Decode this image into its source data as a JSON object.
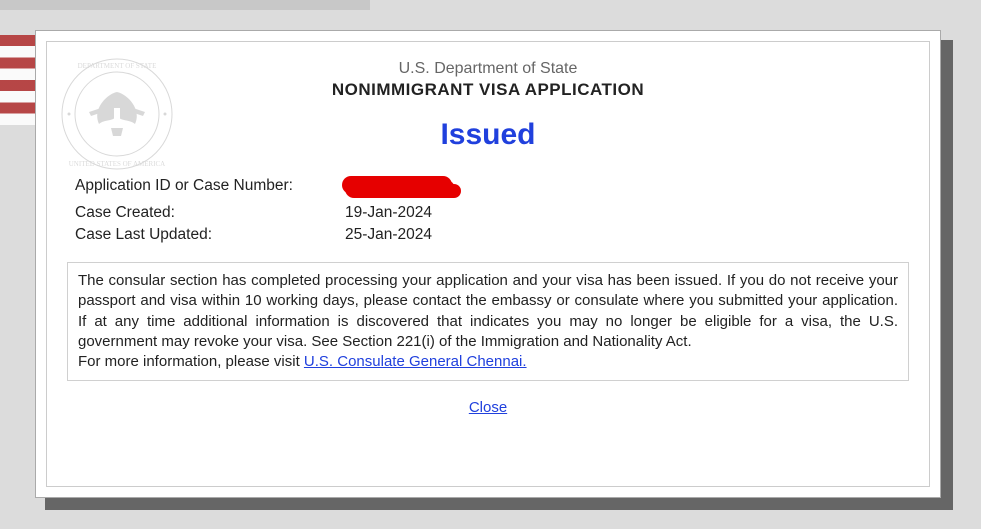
{
  "header": {
    "department": "U.S. Department of State",
    "title": "NONIMMIGRANT VISA APPLICATION"
  },
  "status": "Issued",
  "details": {
    "app_id_label": "Application ID or Case Number:",
    "app_id_value": "",
    "created_label": "Case Created:",
    "created_value": "19-Jan-2024",
    "updated_label": "Case Last Updated:",
    "updated_value": "25-Jan-2024"
  },
  "message": {
    "body": "The consular section has completed processing your application and your visa has been issued. If you do not receive your passport and visa within 10 working days, please contact the embassy or consulate where you submitted your application. If at any time additional information is discovered that indicates you may no longer be eligible for a visa, the U.S. government may revoke your visa. See Section 221(i) of the Immigration and Nationality Act.",
    "more_info_prefix": "For more information, please visit ",
    "link_text": "U.S. Consulate General Chennai."
  },
  "close_label": "Close"
}
